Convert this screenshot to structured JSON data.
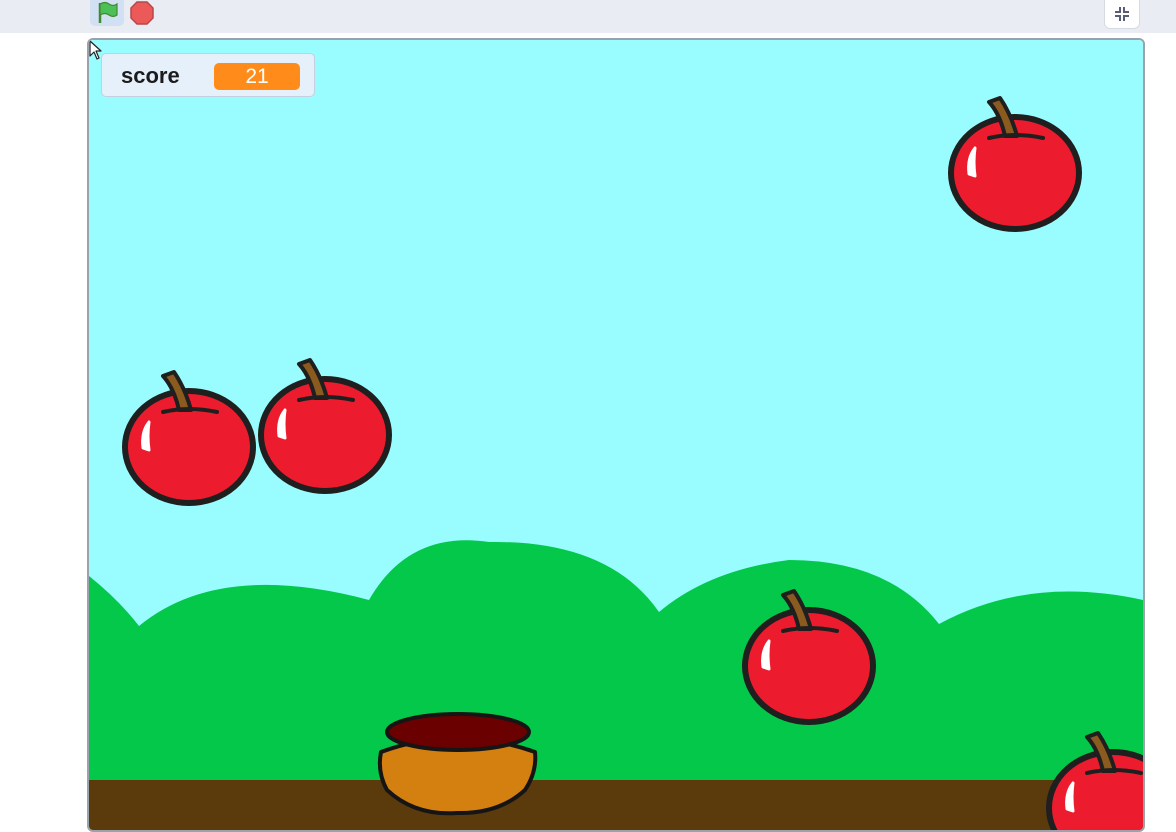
{
  "toolbar": {
    "green_flag": "green-flag-icon",
    "stop": "stop-icon",
    "fullscreen": "exit-fullscreen-icon"
  },
  "stage": {
    "score_monitor": {
      "label": "score",
      "value": "21"
    },
    "colors": {
      "sky": "#99fcfe",
      "hills": "#04c84a",
      "ground": "#5b3a0c",
      "apple": "#ec1c2e",
      "bowl": "#d38011"
    },
    "sprites": [
      "apple",
      "apple",
      "apple",
      "apple",
      "apple",
      "bowl"
    ]
  }
}
